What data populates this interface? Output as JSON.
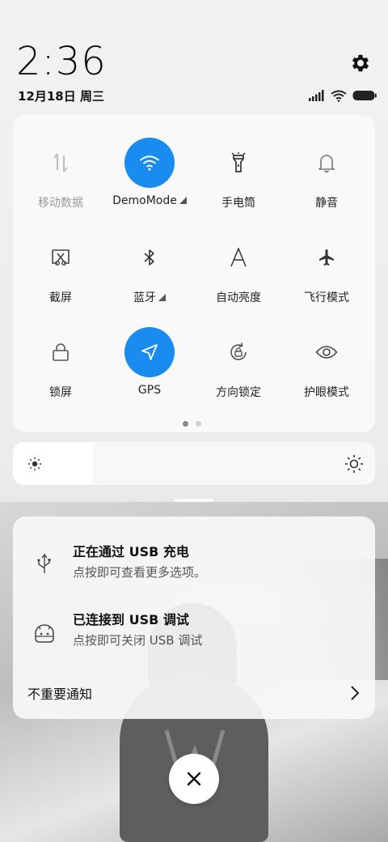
{
  "status": {
    "time": "2:36",
    "date": "12月18日 周三",
    "icons": [
      "signal-icon",
      "wifi-icon",
      "battery-icon"
    ],
    "settings_icon": "gear-icon"
  },
  "toggles": [
    {
      "label": "移动数据",
      "icon": "mobile-data-icon",
      "state": "disabled"
    },
    {
      "label": "DemoMode",
      "icon": "wifi-icon",
      "state": "on",
      "has_menu": true
    },
    {
      "label": "手电筒",
      "icon": "flashlight-icon",
      "state": "off"
    },
    {
      "label": "静音",
      "icon": "bell-icon",
      "state": "off"
    },
    {
      "label": "截屏",
      "icon": "screenshot-icon",
      "state": "off"
    },
    {
      "label": "蓝牙",
      "icon": "bluetooth-icon",
      "state": "off",
      "has_menu": true
    },
    {
      "label": "自动亮度",
      "icon": "auto-brightness-icon",
      "state": "off"
    },
    {
      "label": "飞行模式",
      "icon": "airplane-icon",
      "state": "off"
    },
    {
      "label": "锁屏",
      "icon": "lock-icon",
      "state": "off"
    },
    {
      "label": "GPS",
      "icon": "location-arrow-icon",
      "state": "on"
    },
    {
      "label": "方向锁定",
      "icon": "rotation-lock-icon",
      "state": "off"
    },
    {
      "label": "护眼模式",
      "icon": "eye-icon",
      "state": "off"
    }
  ],
  "pages": {
    "count": 2,
    "active": 0
  },
  "brightness": {
    "level": 0.22,
    "low_icon": "sun-small-icon",
    "high_icon": "sun-large-icon"
  },
  "notifications": [
    {
      "title": "正在通过 USB 充电",
      "subtitle": "点按即可查看更多选项。",
      "icon": "usb-icon"
    },
    {
      "title": "已连接到 USB 调试",
      "subtitle": "点按即可关闭 USB 调试",
      "icon": "android-icon"
    }
  ],
  "unimportant_label": "不重要通知",
  "accent_color": "#1a8cf0",
  "close_icon": "close-icon"
}
